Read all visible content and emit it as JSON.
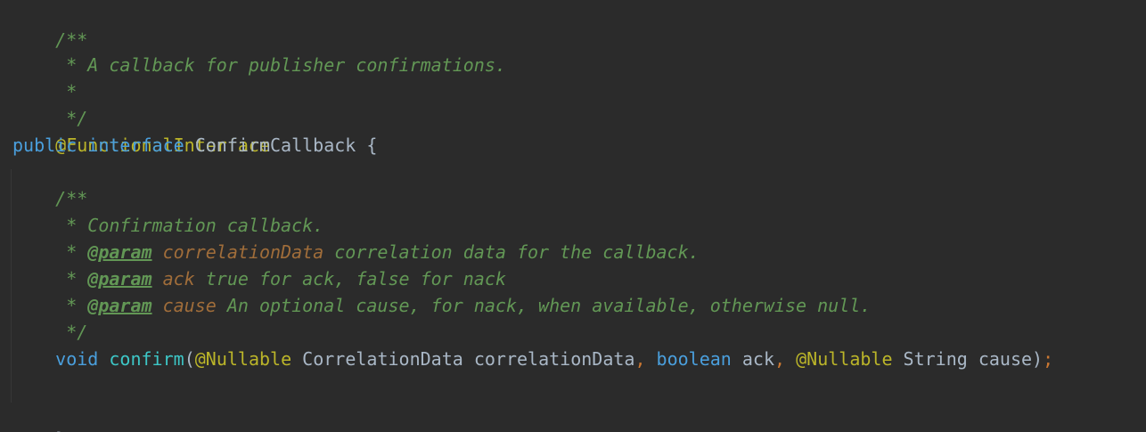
{
  "code": {
    "l1": "/**",
    "l2": " * A callback for publisher confirmations.",
    "l3": " *",
    "l4": " */",
    "l5_anno": "@FunctionalInterface",
    "l6_public": "public",
    "l6_interface": "interface",
    "l6_name": "ConfirmCallback",
    "l6_brace": "{",
    "l8": "/**",
    "l9": " * Confirmation callback.",
    "param_prefix": " * ",
    "param_tag": "@param",
    "l10_name": "correlationData",
    "l10_desc": " correlation data for the callback.",
    "l11_name": "ack",
    "l11_desc": " true for ack, false for nack",
    "l12_name": "cause",
    "l12_desc": " An optional cause, for nack, when available, otherwise null.",
    "l13": " */",
    "l14_void": "void",
    "l14_fn": "confirm",
    "l14_paren_open": "(",
    "l14_anno1": "@Nullable",
    "l14_type1": "CorrelationData",
    "l14_arg1": "correlationData",
    "l14_comma": ",",
    "l14_boolean": "boolean",
    "l14_arg2": "ack",
    "l14_anno2": "@Nullable",
    "l14_type2": "String",
    "l14_arg3": "cause",
    "l14_paren_close": ")",
    "l14_semicolon": ";",
    "l16_brace": "}"
  },
  "colors": {
    "background": "#2b2b2b",
    "comment": "#629755",
    "doc_param_name": "#a06d3a",
    "annotation": "#bbb529",
    "keyword": "#4a9fdd",
    "method": "#3dc7c7",
    "text": "#a9b7c6",
    "punctuation": "#cc7832"
  }
}
